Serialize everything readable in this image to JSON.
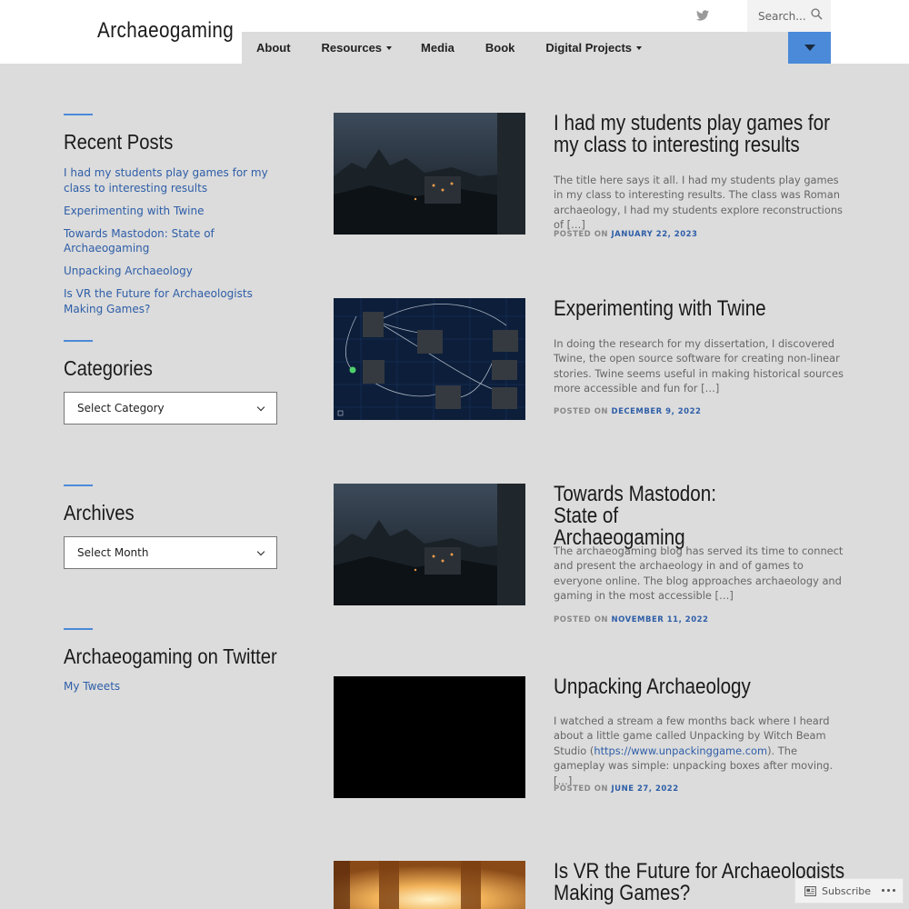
{
  "site": {
    "title": "Archaeogaming"
  },
  "nav": {
    "items": [
      {
        "label": "About",
        "has_caret": false
      },
      {
        "label": "Resources",
        "has_caret": true
      },
      {
        "label": "Media",
        "has_caret": false
      },
      {
        "label": "Book",
        "has_caret": false
      },
      {
        "label": "Digital Projects",
        "has_caret": true
      }
    ],
    "search_placeholder": "Search...",
    "accent_color": "#4a8ad9"
  },
  "sidebar": {
    "recent_posts": {
      "title": "Recent Posts",
      "items": [
        "I had my students play games for my class to interesting results",
        "Experimenting with Twine",
        "Towards Mastodon: State of Archaeogaming",
        "Unpacking Archaeology",
        "Is VR the Future for Archaeologists Making Games?"
      ]
    },
    "categories": {
      "title": "Categories",
      "select_value": "Select Category"
    },
    "archives": {
      "title": "Archives",
      "select_value": "Select Month"
    },
    "twitter": {
      "title": "Archaeogaming on Twitter",
      "link": "My Tweets"
    }
  },
  "posts": [
    {
      "title": "I had my students play games for my class to interesting results",
      "excerpt": "The title here says it all. I had my students play games in my class to interesting results. The class was Roman archaeology, I had my students explore reconstructions of […]",
      "posted_label": "POSTED ON",
      "date": "JANUARY 22, 2023",
      "thumb": "night-town"
    },
    {
      "title": "Experimenting with Twine",
      "excerpt": "In doing the research for my dissertation, I discovered Twine, the open source software for creating non-linear stories. Twine seems useful in making historical sources more accessible and fun for […]",
      "posted_label": "POSTED ON",
      "date": "DECEMBER 9, 2022",
      "thumb": "twine-map"
    },
    {
      "title": "Towards Mastodon: State of Archaeogaming",
      "excerpt": "The archaeogaming blog has served its time to connect and present the archaeology in and of games to everyone online. The blog approaches archaeology and gaming in the most accessible […]",
      "posted_label": "POSTED ON",
      "date": "NOVEMBER 11, 2022",
      "thumb": "night-town"
    },
    {
      "title": "Unpacking Archaeology",
      "excerpt_before": "I watched a stream a few months back where I heard about a little game called Unpacking by Witch Beam Studio (",
      "excerpt_link": "https://www.unpackinggame.com",
      "excerpt_after": "). The gameplay was simple: unpacking boxes after moving. […]",
      "posted_label": "POSTED ON",
      "date": "JUNE 27, 2022",
      "thumb": "black"
    },
    {
      "title": "Is VR the Future for Archaeologists Making Games?",
      "thumb": "desert-light"
    }
  ],
  "subscribe": {
    "label": "Subscribe"
  }
}
